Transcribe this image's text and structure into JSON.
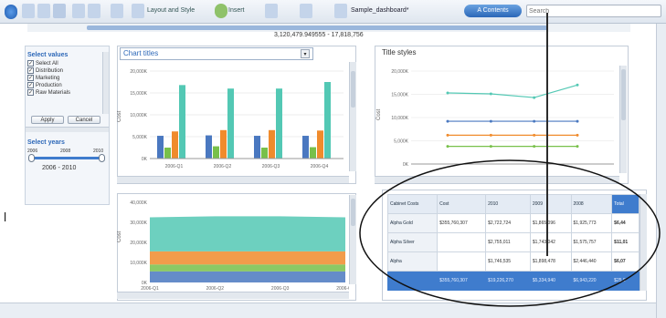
{
  "toolbar": {
    "layout_label": "Layout and Style",
    "insert_label": "Insert",
    "doc_name": "Sample_dashboard*",
    "pill_label": "A Contents",
    "search_placeholder": "Search"
  },
  "range_label": "3,120,479.949555 - 17,818,756",
  "left_panel": {
    "select_values_title": "Select values",
    "items": [
      {
        "label": "Select All",
        "checked": true
      },
      {
        "label": "Distribution",
        "checked": true
      },
      {
        "label": "Marketing",
        "checked": true
      },
      {
        "label": "Production",
        "checked": true
      },
      {
        "label": "Raw Materials",
        "checked": true
      }
    ],
    "apply_label": "Apply",
    "cancel_label": "Cancel",
    "select_years_title": "Select years",
    "year_ticks": [
      "2006",
      "2008",
      "2010"
    ],
    "year_range": "2006 - 2010"
  },
  "bar_panel": {
    "title": "Chart titles",
    "y_ticks": [
      "20,000K",
      "15,000K",
      "10,000K",
      "5,000K",
      "0K"
    ],
    "x_labels": [
      "2006-Q1",
      "2006-Q2",
      "2006-Q3",
      "2006-Q4"
    ],
    "y_label": "Cost"
  },
  "line_panel": {
    "title": "Title styles",
    "y_ticks": [
      "20,000K",
      "15,000K",
      "10,000K",
      "5,000K",
      "0K"
    ],
    "y_label": "Cost"
  },
  "area_panel": {
    "y_ticks": [
      "40,000K",
      "30,000K",
      "20,000K",
      "10,000K",
      "0K"
    ],
    "x_labels": [
      "2006-Q1",
      "2006-Q2",
      "2006-Q3",
      "2006-Q4"
    ],
    "y_label": "Cost"
  },
  "colors": {
    "blue": "#4a78c0",
    "green": "#78c04a",
    "orange": "#f08b2c",
    "teal": "#53c8b4",
    "accent": "#3f7ccd"
  },
  "table": {
    "headers": [
      "Cabinet Costs",
      "Cost",
      "2010",
      "2009",
      "2008",
      "Total"
    ],
    "rows": [
      [
        "Alpha Gold",
        "$355,760,307",
        "$2,722,724",
        "$1,865,096",
        "$1,925,773",
        "$6,44"
      ],
      [
        "Alpha Silver",
        "",
        "$2,755,011",
        "$1,743,042",
        "$1,575,757",
        "$11,01"
      ],
      [
        "Alpha",
        "",
        "$1,746,535",
        "$1,898,478",
        "$2,446,440",
        "$6,07"
      ]
    ],
    "footer": [
      "",
      "$355,760,307",
      "$19,226,270",
      "$5,334,940",
      "$6,943,220",
      "$25,9"
    ]
  },
  "chart_data": [
    {
      "type": "bar",
      "title": "Chart titles",
      "ylabel": "Cost",
      "categories": [
        "2006-Q1",
        "2006-Q2",
        "2006-Q3",
        "2006-Q4"
      ],
      "series": [
        {
          "values": [
            5200,
            5300,
            5200,
            5200
          ]
        },
        {
          "values": [
            2500,
            2800,
            2500,
            2600
          ]
        },
        {
          "values": [
            6200,
            6500,
            6500,
            6400
          ]
        },
        {
          "values": [
            16800,
            16000,
            16000,
            17500
          ]
        }
      ],
      "ylim": [
        0,
        20000
      ]
    },
    {
      "type": "line",
      "title": "Title styles",
      "ylabel": "Cost",
      "series": [
        {
          "values": [
            15300,
            15100,
            14300,
            17000
          ]
        },
        {
          "values": [
            9200,
            9200,
            9200,
            9200
          ]
        },
        {
          "values": [
            6200,
            6200,
            6200,
            6200
          ]
        },
        {
          "values": [
            3800,
            3800,
            3800,
            3800
          ]
        }
      ],
      "ylim": [
        0,
        20000
      ]
    },
    {
      "type": "area",
      "ylabel": "Cost",
      "categories": [
        "2006-Q1",
        "2006-Q2",
        "2006-Q3",
        "2006-Q4"
      ],
      "series": [
        {
          "values": [
            5500,
            5500,
            5500,
            5500
          ]
        },
        {
          "values": [
            3500,
            3500,
            3500,
            3500
          ]
        },
        {
          "values": [
            6500,
            6500,
            6500,
            6500
          ]
        },
        {
          "values": [
            17000,
            17500,
            17500,
            17000
          ]
        }
      ],
      "ylim": [
        0,
        40000
      ]
    }
  ]
}
